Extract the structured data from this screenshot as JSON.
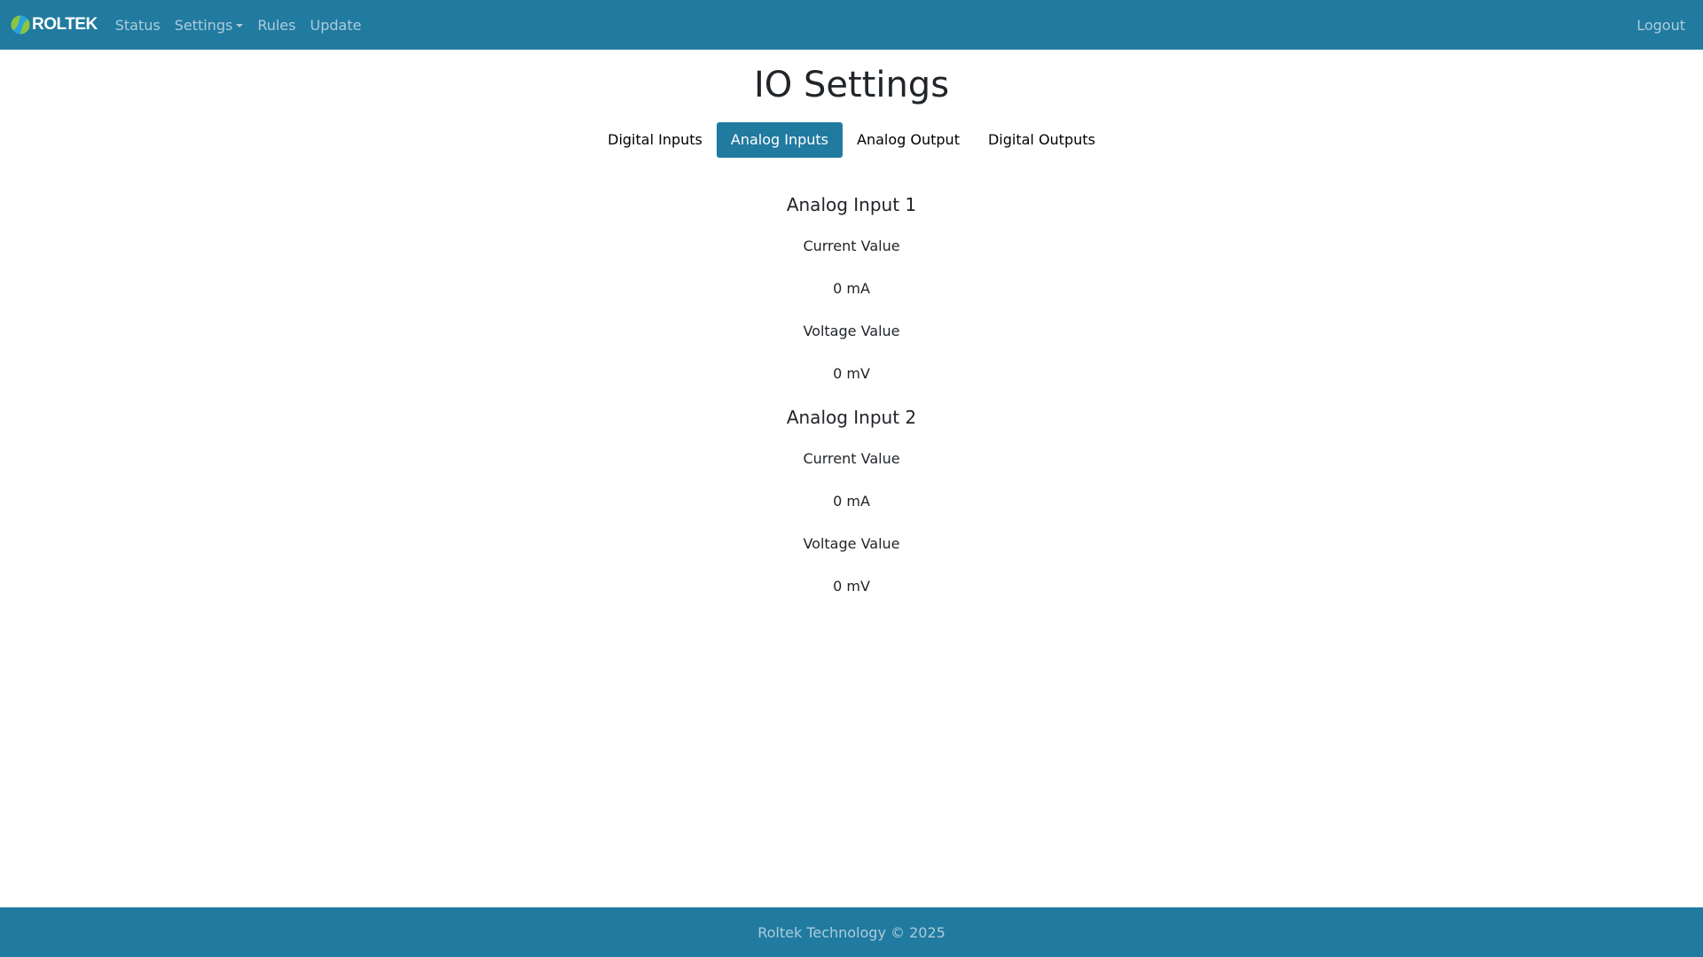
{
  "navbar": {
    "brand": "ROLTEK",
    "links": [
      "Status",
      "Settings",
      "Rules",
      "Update"
    ],
    "logout": "Logout"
  },
  "page": {
    "title": "IO Settings"
  },
  "tabs": [
    {
      "label": "Digital Inputs",
      "active": false
    },
    {
      "label": "Analog Inputs",
      "active": true
    },
    {
      "label": "Analog Output",
      "active": false
    },
    {
      "label": "Digital Outputs",
      "active": false
    }
  ],
  "inputs": [
    {
      "title": "Analog Input 1",
      "current_label": "Current Value",
      "current_value": "0 mA",
      "voltage_label": "Voltage Value",
      "voltage_value": "0 mV"
    },
    {
      "title": "Analog Input 2",
      "current_label": "Current Value",
      "current_value": "0 mA",
      "voltage_label": "Voltage Value",
      "voltage_value": "0 mV"
    }
  ],
  "footer": {
    "text": "Roltek Technology © 2025"
  },
  "colors": {
    "primary": "#217aa0",
    "logo_green": "#8cc63f",
    "logo_blue": "#29a3dd"
  }
}
